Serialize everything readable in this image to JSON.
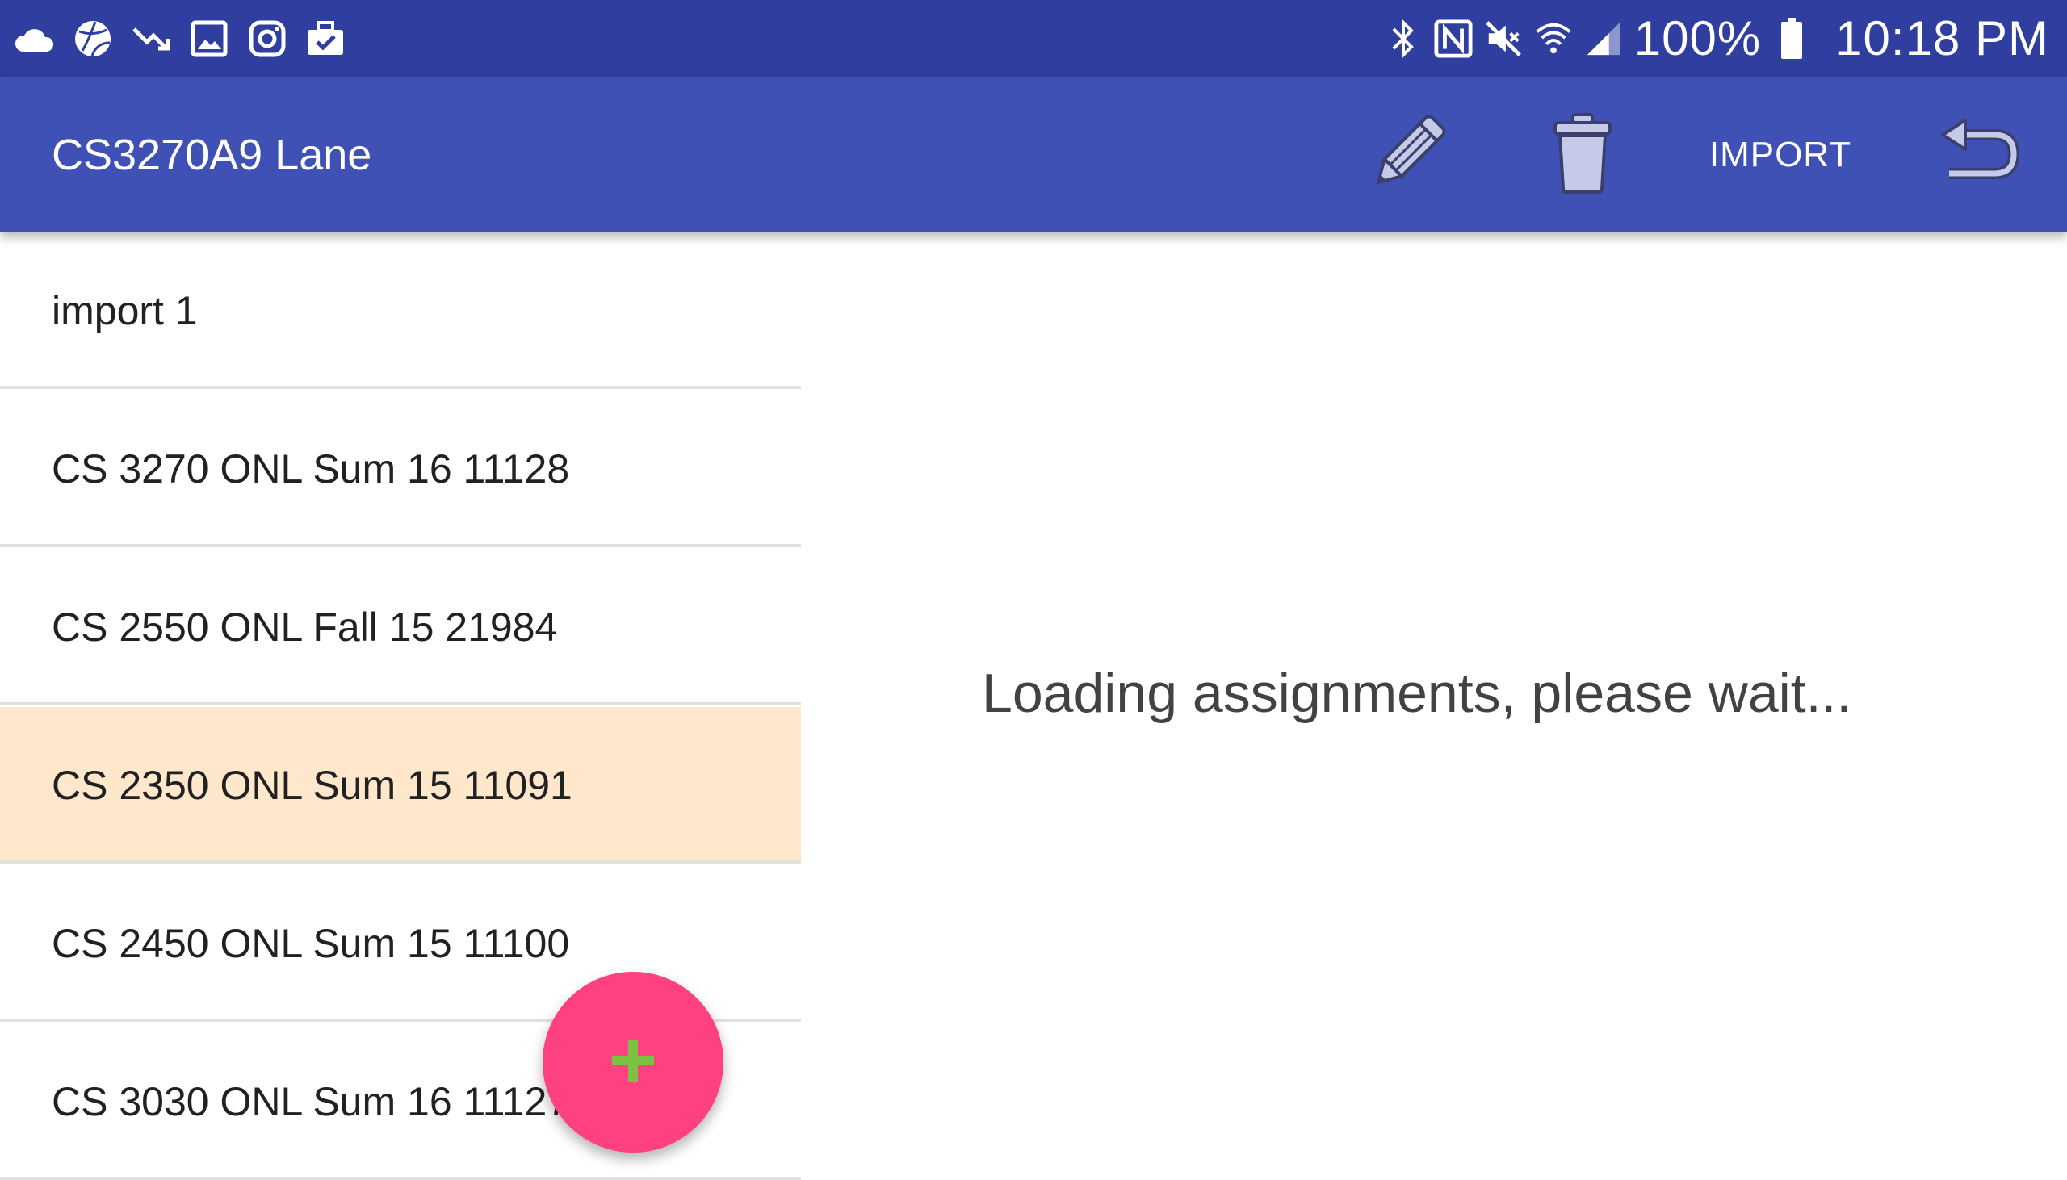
{
  "status_bar": {
    "left_icons": [
      "cloud-icon",
      "volleyball-icon",
      "trending-down-icon",
      "gallery-icon",
      "instagram-icon",
      "briefcase-check-icon"
    ],
    "right_icons": [
      "bluetooth-icon",
      "nfc-icon",
      "mute-icon",
      "wifi-icon",
      "signal-icon"
    ],
    "battery": "100%",
    "time": "10:18 PM"
  },
  "app_bar": {
    "title": "CS3270A9 Lane",
    "actions": {
      "edit_icon": "pencil-icon",
      "delete_icon": "trash-icon",
      "import_label": "IMPORT",
      "back_icon": "undo-icon"
    }
  },
  "course_list": {
    "items": [
      {
        "label": "import 1"
      },
      {
        "label": "CS 3270 ONL Sum 16 11128"
      },
      {
        "label": "CS 2550 ONL Fall 15 21984"
      },
      {
        "label": "CS 2350 ONL Sum 15 11091"
      },
      {
        "label": "CS 2450 ONL Sum 15 11100"
      },
      {
        "label": "CS 3030 ONL Sum 16 11127"
      }
    ],
    "selected_index": 3
  },
  "main": {
    "loading_message": "Loading assignments, please wait..."
  },
  "fab": {
    "icon": "plus-icon"
  },
  "colors": {
    "status_bar": "#303f9f",
    "app_bar": "#3f51b5",
    "selected_row": "#ffe7cc",
    "fab": "#ff4081",
    "fab_icon": "#7cc242"
  }
}
